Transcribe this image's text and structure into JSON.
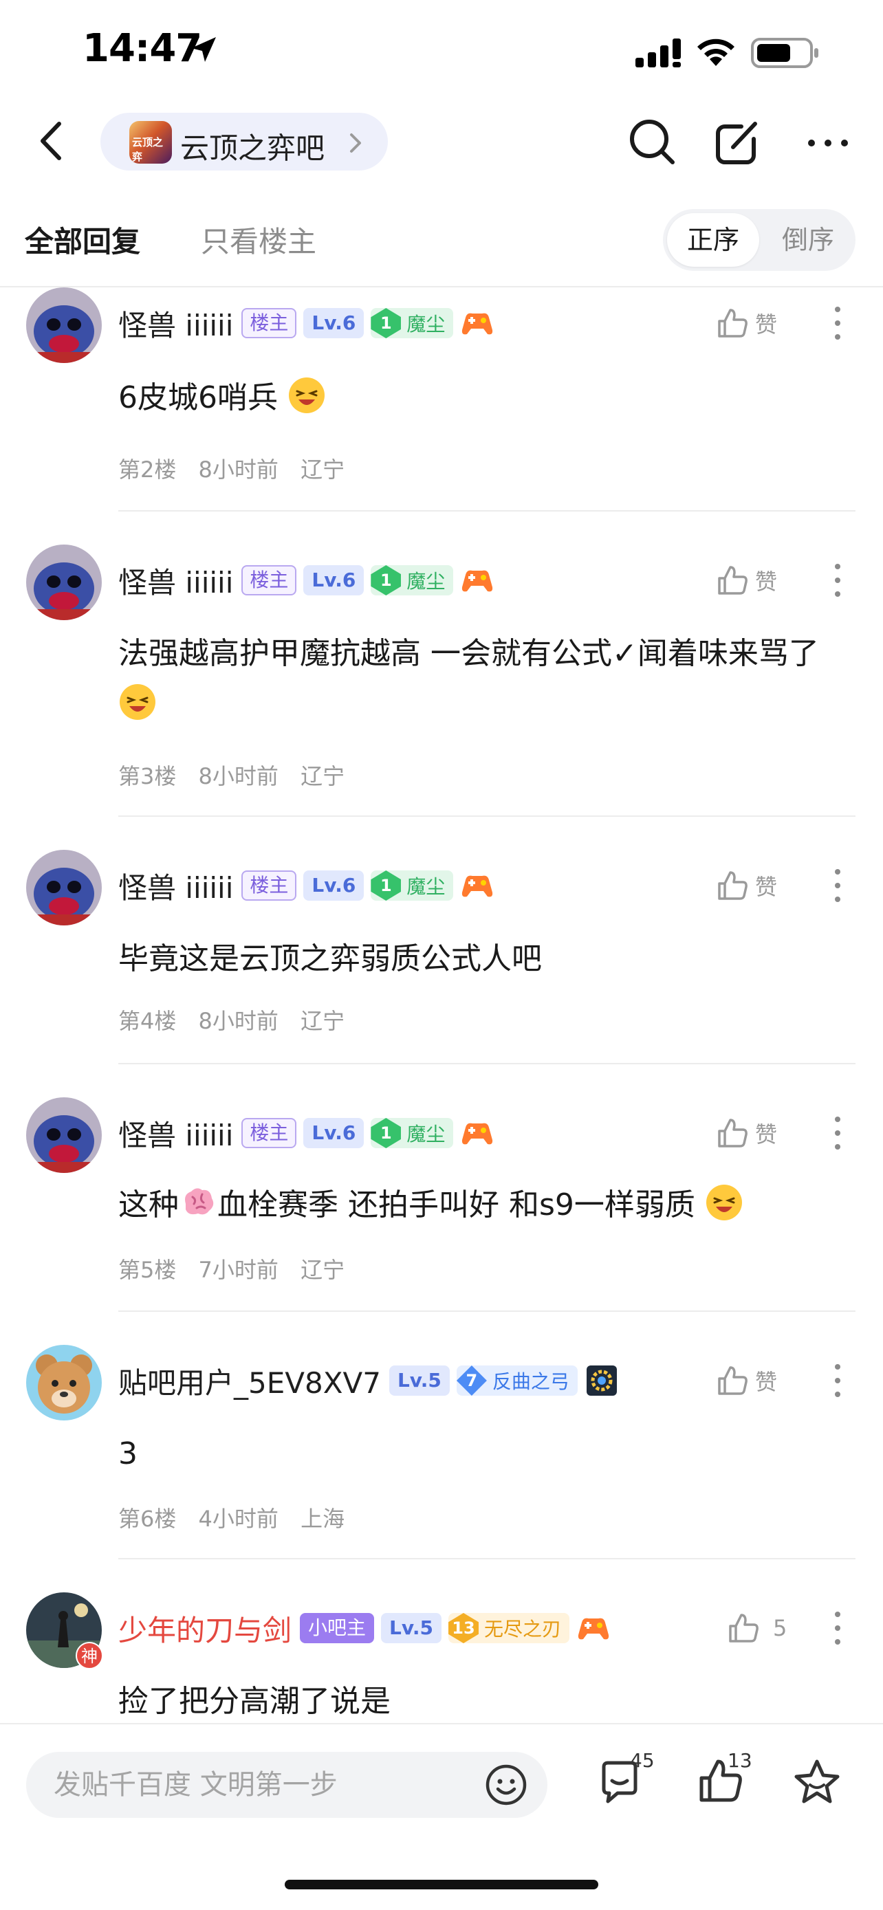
{
  "status_bar": {
    "time": "14:47"
  },
  "nav": {
    "forum_name": "云顶之弈吧",
    "forum_logo_text": "云顶之弈"
  },
  "filter": {
    "tab_all": "全部回复",
    "tab_owner": "只看楼主",
    "sort_asc": "正序",
    "sort_desc": "倒序"
  },
  "posts": [
    {
      "username": "怪兽 iiiiii",
      "owner_badge": "楼主",
      "level": "Lv.6",
      "title_level": "1",
      "title": "魔尘",
      "like_label": "赞",
      "text": "6皮城6哨兵",
      "floor": "第2楼",
      "time": "8小时前",
      "location": "辽宁"
    },
    {
      "username": "怪兽 iiiiii",
      "owner_badge": "楼主",
      "level": "Lv.6",
      "title_level": "1",
      "title": "魔尘",
      "like_label": "赞",
      "text": "法强越高护甲魔抗越高 一会就有公式✓闻着味来骂了",
      "floor": "第3楼",
      "time": "8小时前",
      "location": "辽宁"
    },
    {
      "username": "怪兽 iiiiii",
      "owner_badge": "楼主",
      "level": "Lv.6",
      "title_level": "1",
      "title": "魔尘",
      "like_label": "赞",
      "text": "毕竟这是云顶之弈弱质公式人吧",
      "floor": "第4楼",
      "time": "8小时前",
      "location": "辽宁"
    },
    {
      "username": "怪兽 iiiiii",
      "owner_badge": "楼主",
      "level": "Lv.6",
      "title_level": "1",
      "title": "魔尘",
      "like_label": "赞",
      "text_before": "这种",
      "text_after": "血栓赛季 还拍手叫好 和s9一样弱质",
      "floor": "第5楼",
      "time": "7小时前",
      "location": "辽宁"
    },
    {
      "username": "贴吧用户_5EV8XV7",
      "level": "Lv.5",
      "title_level": "7",
      "title": "反曲之弓",
      "like_label": "赞",
      "text": "3",
      "floor": "第6楼",
      "time": "4小时前",
      "location": "上海"
    },
    {
      "username": "少年的刀与剑",
      "submod_badge": "小吧主",
      "avatar_badge": "神",
      "level": "Lv.5",
      "title_level": "13",
      "title": "无尽之刃",
      "like_label": "5",
      "text": "捡了把分高潮了说是"
    }
  ],
  "bottom_bar": {
    "input_placeholder": "发贴千百度 文明第一步",
    "comment_count": "45",
    "like_count": "13"
  },
  "colors": {
    "accent_purple": "#7b5fdd",
    "level_blue": "#4a6bd8",
    "title_green": "#2fb061",
    "title_blue": "#3a78e8",
    "title_gold": "#e59a12",
    "name_red": "#e4483f"
  }
}
